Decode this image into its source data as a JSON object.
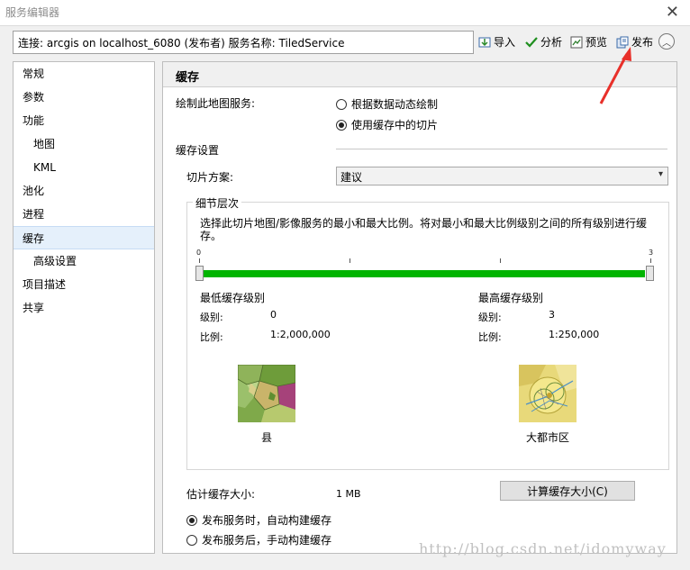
{
  "window": {
    "title": "服务编辑器",
    "close_glyph": "✕"
  },
  "toolbar": {
    "connection": "连接: arcgis on localhost_6080 (发布者)    服务名称: TiledService",
    "import": "导入",
    "analyze": "分析",
    "preview": "预览",
    "publish": "发布",
    "collapse_glyph": "︿"
  },
  "sidebar": {
    "items": [
      {
        "label": "常规",
        "sub": false
      },
      {
        "label": "参数",
        "sub": false
      },
      {
        "label": "功能",
        "sub": false
      },
      {
        "label": "地图",
        "sub": true
      },
      {
        "label": "KML",
        "sub": true
      },
      {
        "label": "池化",
        "sub": false
      },
      {
        "label": "进程",
        "sub": false
      },
      {
        "label": "缓存",
        "sub": false,
        "active": true
      },
      {
        "label": "高级设置",
        "sub": true
      },
      {
        "label": "项目描述",
        "sub": false
      },
      {
        "label": "共享",
        "sub": false
      }
    ]
  },
  "panel": {
    "heading": "缓存",
    "draw_label": "绘制此地图服务:",
    "draw_options": [
      {
        "label": "根据数据动态绘制",
        "checked": false
      },
      {
        "label": "使用缓存中的切片",
        "checked": true
      }
    ],
    "cache_settings": "缓存设置",
    "tiling_label": "切片方案:",
    "tiling_value": "建议",
    "dropdown_glyph": "▾",
    "lod": {
      "title": "细节层次",
      "description": "选择此切片地图/影像服务的最小和最大比例。将对最小和最大比例级别之间的所有级别进行缓存。",
      "min_tick": "0",
      "max_tick": "3",
      "min_title": "最低缓存级别",
      "max_title": "最高缓存级别",
      "level_label": "级别:",
      "scale_label": "比例:",
      "min_level": "0",
      "min_scale": "1:2,000,000",
      "max_level": "3",
      "max_scale": "1:250,000",
      "min_caption": "县",
      "max_caption": "大都市区"
    },
    "estimate_label": "估计缓存大小:",
    "estimate_value": "1 MB",
    "calc_button": "计算缓存大小(C)",
    "build_options": [
      {
        "label": "发布服务时，自动构建缓存",
        "checked": true
      },
      {
        "label": "发布服务后，手动构建缓存",
        "checked": false
      }
    ]
  },
  "watermark": "http://blog.csdn.net/idomyway",
  "colors": {
    "slider_green": "#00b400",
    "annotation_red": "#e8302a",
    "selection_blue": "#e5f0fb"
  }
}
